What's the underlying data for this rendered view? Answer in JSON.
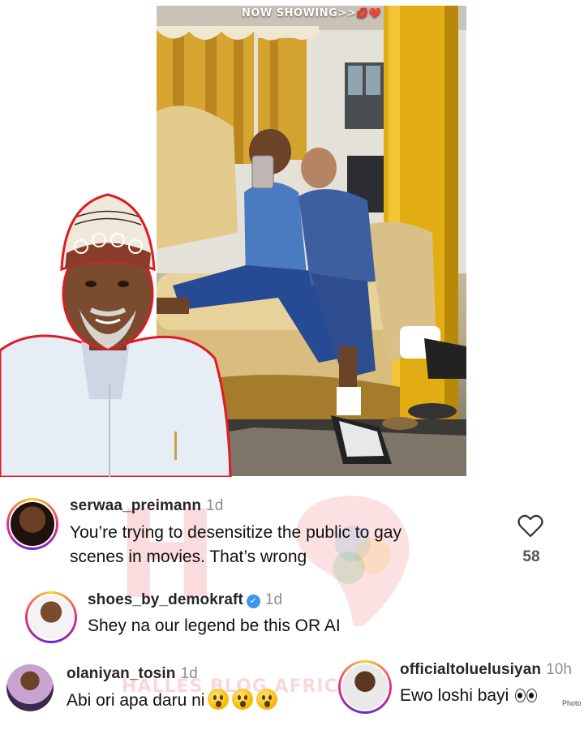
{
  "video": {
    "banner": "NOW SHOWING>>",
    "banner_emoji": "💋❤️"
  },
  "watermark": {
    "letter": "H",
    "text": "HALLES BLOG AFRICA"
  },
  "comments": [
    {
      "username": "serwaa_preimann",
      "time": "1d",
      "text_line1": "You’re trying to desensitize the public to gay",
      "text_line2": "scenes in movies. That’s wrong",
      "likes": "58"
    },
    {
      "username": "shoes_by_demokraft",
      "time": "1d",
      "verified": true,
      "text": "Shey na our legend be this OR AI"
    },
    {
      "username": "olaniyan_tosin",
      "time": "1d",
      "text": "Abi ori apa daru ni"
    },
    {
      "username": "officialtoluelusiyan",
      "time": "10h",
      "text": "Ewo loshi bayi"
    }
  ],
  "credit": "Photo",
  "colors": {
    "story_ring": "#ee2a7b",
    "verified_badge": "#3897f0",
    "portrait_outline": "#e01b24",
    "curtain_gold": "#d8a630"
  },
  "icons": [
    "heart-outline-icon",
    "verified-badge-icon",
    "astonished-face-emoji",
    "eyes-emoji"
  ]
}
